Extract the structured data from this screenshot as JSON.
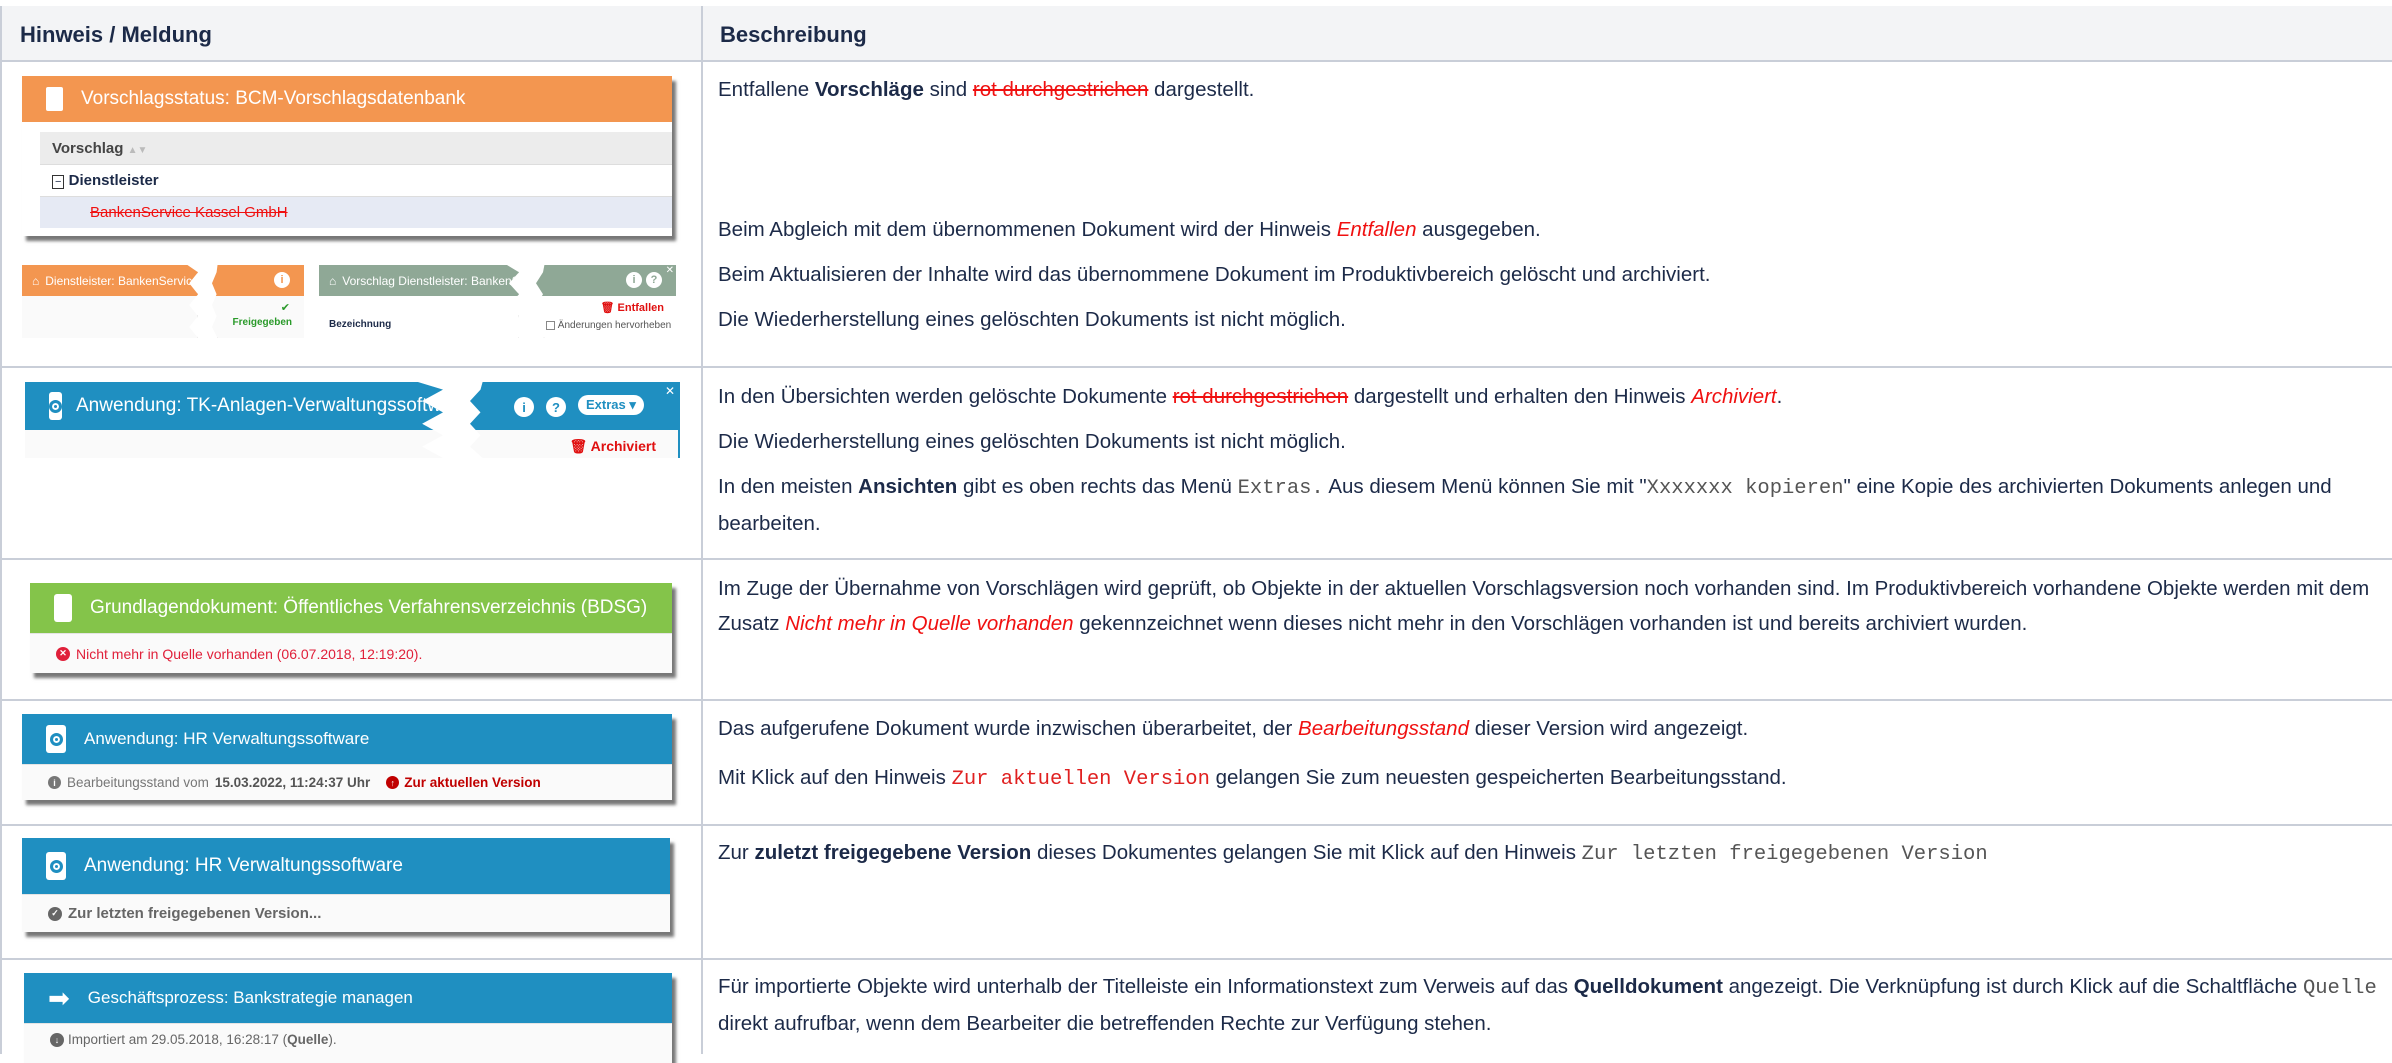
{
  "header": {
    "col1": "Hinweis / Meldung",
    "col2": "Beschreibung"
  },
  "colors": {
    "orange": "#f39650",
    "blue": "#1f8fc1",
    "green": "#84c44a",
    "sage": "#8fa896",
    "red": "#f01010"
  },
  "rows": [
    {
      "shot": {
        "title": "Vorschlagsstatus: BCM-Vorschlagsdatenbank",
        "column": "Vorschlag",
        "group": "Dienstleister",
        "item": "BankenService Kassel GmbH",
        "piece1": "Dienstleister: BankenServic",
        "piece2": "Freigegeben",
        "piece3": "Vorschlag Dienstleister: BankenS",
        "piece3_field": "Bezeichnung",
        "piece4_status": "Entfallen",
        "piece4_checkbox": "Änderungen hervorheben",
        "icons": [
          "document-icon",
          "building-icon",
          "info-icon",
          "check-icon",
          "help-icon",
          "trash-icon",
          "close-icon"
        ]
      },
      "desc": [
        [
          "Entfallene ",
          "Vorschläge",
          " sind ",
          "rot durchgestrichen",
          " dargestellt."
        ],
        [
          "Beim Abgleich mit dem übernommenen Dokument wird der Hinweis ",
          "Entfallen",
          " ausgegeben."
        ],
        [
          "Beim Aktualisieren der Inhalte wird das übernommene Dokument im Produktivbereich gelöscht und archiviert."
        ],
        [
          "Die Wiederherstellung eines gelöschten Dokuments ist nicht möglich."
        ]
      ]
    },
    {
      "shot": {
        "title": "Anwendung: TK-Anlagen-Verwaltungssoftware",
        "extras": "Extras",
        "status": "Archiviert"
      },
      "desc": [
        [
          "In den Übersichten werden gelöschte Dokumente ",
          "rot durchgestrichen",
          " dargestellt und erhalten den Hinweis ",
          "Archiviert",
          "."
        ],
        [
          "Die Wiederherstellung eines gelöschten Dokuments ist nicht möglich."
        ],
        [
          "In den meisten ",
          "Ansichten",
          " gibt es oben rechts das Menü ",
          "Extras.",
          " Aus diesem Menü können Sie mit \"",
          "Xxxxxxx kopieren",
          "\" eine Kopie des archivierten Dokuments anlegen und bearbeiten."
        ]
      ]
    },
    {
      "shot": {
        "title": "Grundlagendokument: Öffentliches Verfahrensverzeichnis (BDSG)",
        "status": "Nicht mehr in Quelle vorhanden (06.07.2018, 12:19:20)."
      },
      "desc": [
        [
          "Im Zuge der Übernahme von Vorschlägen wird geprüft, ob Objekte in der aktuellen Vorschlagsversion noch vorhanden sind. Im Produktivbereich vorhandene Objekte werden mit dem Zusatz ",
          "Nicht mehr in Quelle vorhanden",
          " gekennzeichnet wenn dieses nicht mehr in den Vorschlägen vorhanden ist und bereits archiviert wurden."
        ]
      ]
    },
    {
      "shot": {
        "title": "Anwendung: HR Verwaltungssoftware",
        "status_prefix": "Bearbeitungsstand vom ",
        "status_date": "15.03.2022, 11:24:37 Uhr",
        "link": "Zur aktuellen Version"
      },
      "desc": [
        [
          "Das aufgerufene Dokument wurde inzwischen überarbeitet, der ",
          "Bearbeitungsstand",
          " dieser Version wird angezeigt."
        ],
        [
          "Mit Klick auf den Hinweis ",
          "Zur aktuellen Version",
          " gelangen Sie zum neuesten gespeicherten Bearbeitungsstand."
        ]
      ]
    },
    {
      "shot": {
        "title": "Anwendung: HR Verwaltungssoftware",
        "link": "Zur letzten freigegebenen Version..."
      },
      "desc": [
        [
          "Zur ",
          "zuletzt freigegebene Version",
          " dieses Dokumentes gelangen Sie mit Klick auf den Hinweis ",
          "Zur letzten freigegebenen Version"
        ]
      ]
    },
    {
      "shot": {
        "title": "Geschäftsprozess: Bankstrategie managen",
        "status_prefix": "Importiert am 29.05.2018, 16:28:17 (",
        "status_link": "Quelle",
        "status_suffix": ")."
      },
      "desc": [
        [
          "Für importierte Objekte wird unterhalb der Titelleiste ein Informationstext zum Verweis auf das ",
          "Quelldokument",
          " angezeigt. Die Verknüpfung ist durch Klick auf die Schaltfläche ",
          "Quelle",
          " direkt aufrufbar, wenn dem Bearbeiter die betreffenden Rechte zur Verfügung stehen."
        ]
      ]
    }
  ]
}
